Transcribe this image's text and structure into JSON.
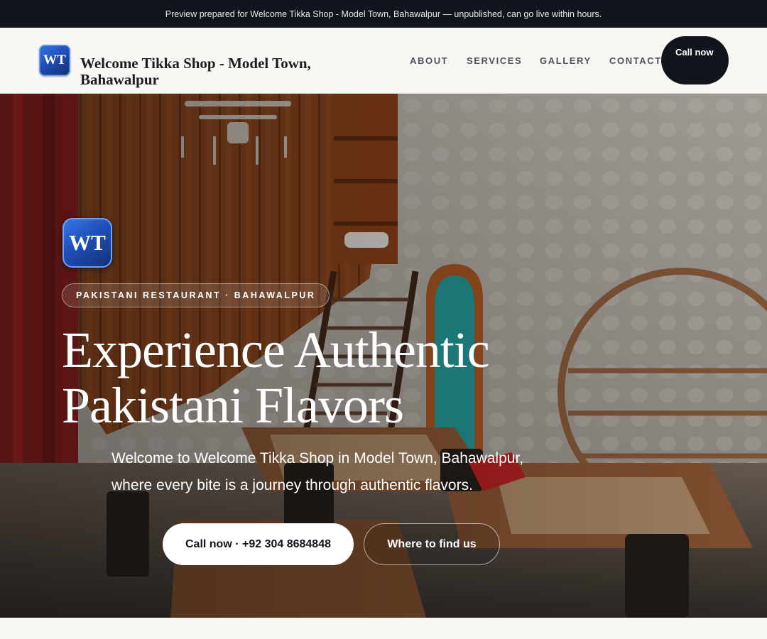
{
  "preview_banner": "Preview prepared for Welcome Tikka Shop - Model Town, Bahawalpur — unpublished, can go live within hours.",
  "brand": {
    "initials": "WT",
    "name": "Welcome Tikka Shop - Model Town, Bahawalpur"
  },
  "nav": {
    "items": [
      "ABOUT",
      "SERVICES",
      "GALLERY",
      "CONTACT"
    ],
    "call_label": "Call now"
  },
  "hero": {
    "initials": "WT",
    "eyebrow": "PAKISTANI RESTAURANT · BAHAWALPUR",
    "headline_line1": "Experience Authentic",
    "headline_line2": "Pakistani Flavors",
    "lede": "Welcome to Welcome Tikka Shop in Model Town, Bahawalpur, where every bite is a journey through authentic flavors.",
    "primary_cta": "Call now · +92 304 8684848",
    "secondary_cta": "Where to find us"
  },
  "colors": {
    "dark": "#12151c",
    "page_bg": "#f8f7f3",
    "logo_blue": "#1f4fb8"
  }
}
